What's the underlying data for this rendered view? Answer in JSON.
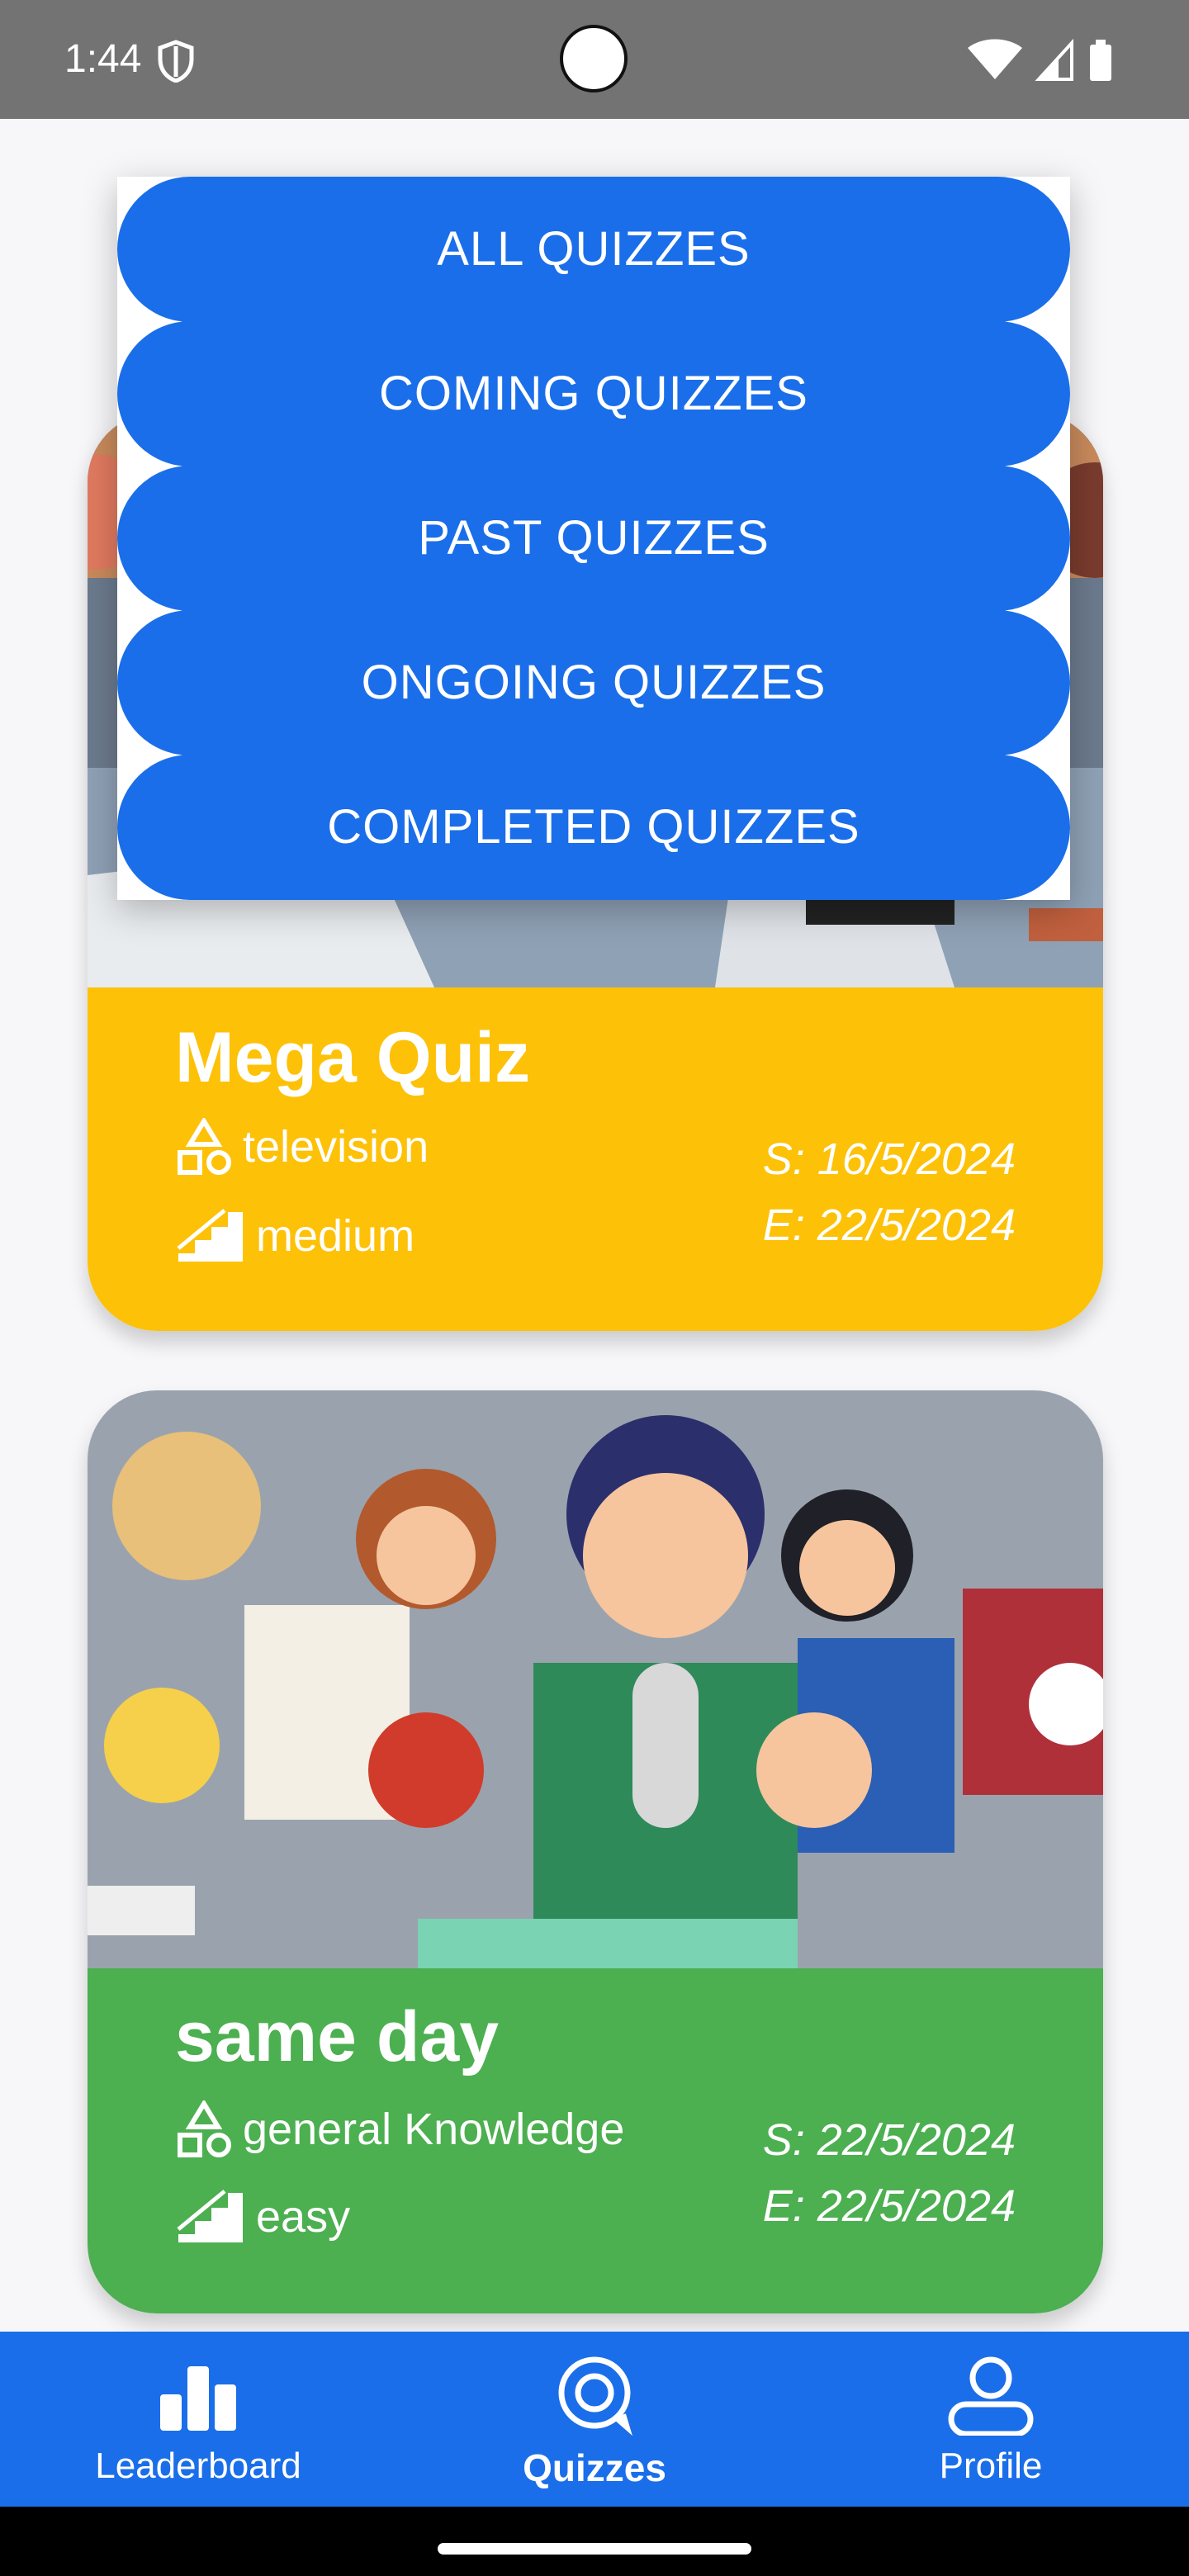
{
  "status_bar": {
    "time": "1:44"
  },
  "dropdown": {
    "items": [
      "ALL QUIZZES",
      "COMING QUIZZES",
      "PAST QUIZZES",
      "ONGOING QUIZZES",
      "COMPLETED QUIZZES"
    ]
  },
  "cards": [
    {
      "title": "Mega Quiz",
      "category": "television",
      "difficulty": "medium",
      "start": "S: 16/5/2024",
      "end": "E: 22/5/2024",
      "color": "#fdc107"
    },
    {
      "title": "same day",
      "category": "general Knowledge",
      "difficulty": "easy",
      "start": "S: 22/5/2024",
      "end": "E: 22/5/2024",
      "color": "#4caf50"
    }
  ],
  "nav": {
    "leaderboard": "Leaderboard",
    "quizzes": "Quizzes",
    "profile": "Profile"
  },
  "colors": {
    "primary": "#1a6ee9",
    "status_bar": "#737373"
  }
}
